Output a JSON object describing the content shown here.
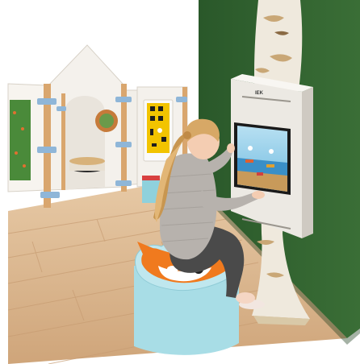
{
  "scene": {
    "kiosk": {
      "brand_text": "IEK",
      "game": "fishing game"
    },
    "stool": {
      "shape": "fox head"
    },
    "colors": {
      "wall_green": "#2e5e2e",
      "floor_wood": "#d9b48c",
      "panel_white": "#f4f2ee",
      "fox_orange": "#f07a1e",
      "stool_teal": "#a8dde6",
      "game_yellow": "#f2c400",
      "screen_sky": "#7fc7e8"
    }
  }
}
